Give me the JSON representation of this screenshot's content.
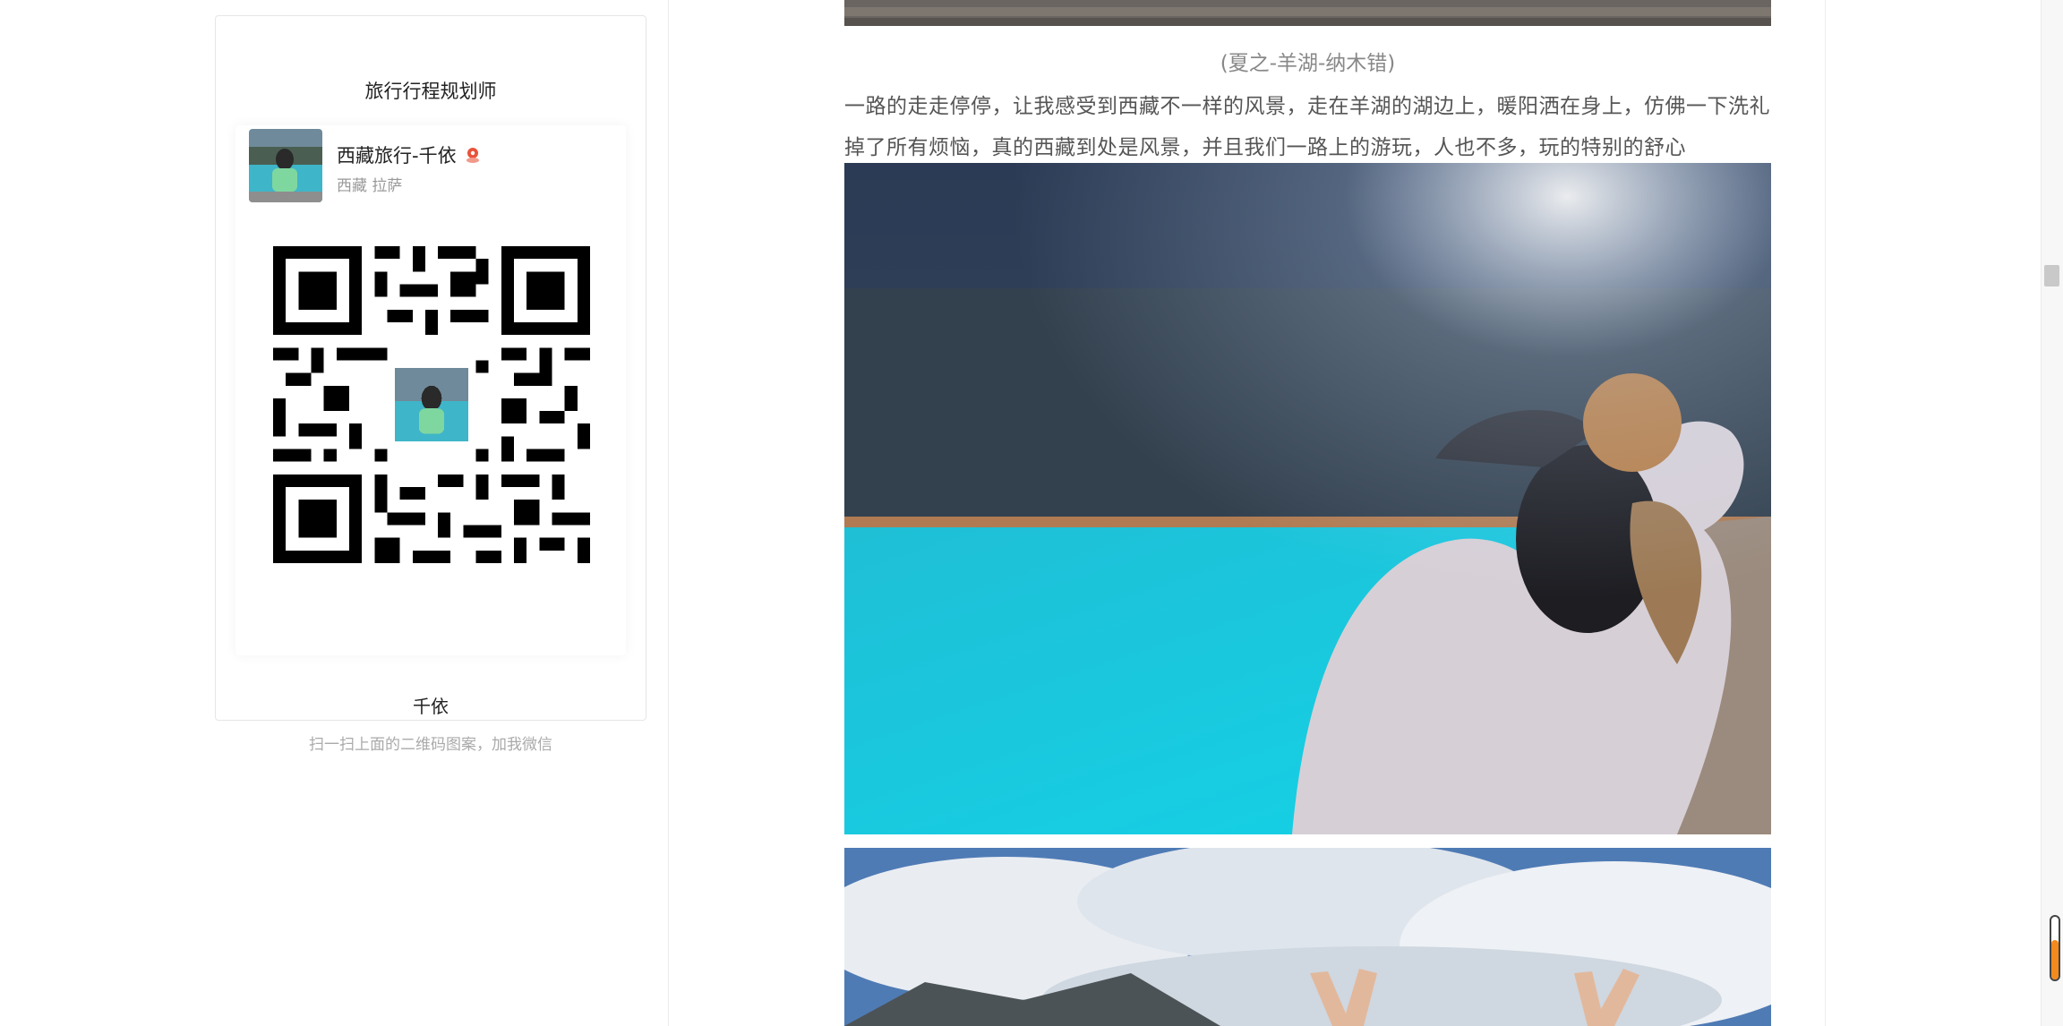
{
  "sidebar_card": {
    "title": "旅行行程规划师",
    "profile_name": "西藏旅行-千依",
    "profile_location": "西藏 拉萨",
    "qr_hint": "扫一扫上面的二维码图案，加我微信",
    "footer_name": "千依"
  },
  "article": {
    "caption": "(夏之-羊湖-纳木错)",
    "paragraph": "一路的走走停停，让我感受到西藏不一样的风景，走在羊湖的湖边上，暖阳洒在身上，仿佛一下洗礼掉了所有烦恼，真的西藏到处是风景，并且我们一路上的游玩，人也不多，玩的特别的舒心"
  },
  "colors": {
    "accent_orange": "#f28a1e",
    "lake_turquoise": "#19c6dc",
    "pin_red": "#e8533b"
  },
  "icons": [
    "location-pin-icon",
    "qr-code-icon"
  ]
}
